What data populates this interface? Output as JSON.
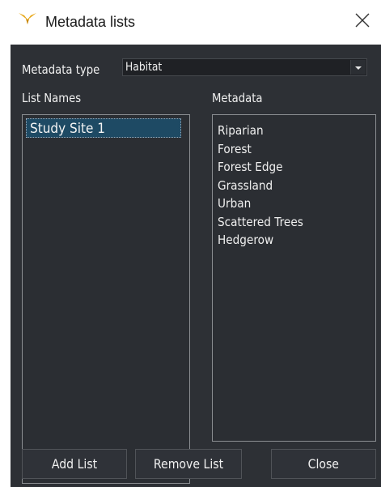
{
  "window": {
    "title": "Metadata lists",
    "app_icon": "bird-logo-icon",
    "close_icon": "close-icon",
    "accent_color": "#e8a91c"
  },
  "metadata_type": {
    "label": "Metadata type",
    "value": "Habitat"
  },
  "list_names": {
    "label": "List Names",
    "items": [
      "Study Site 1"
    ],
    "selected": "Study Site 1"
  },
  "metadata": {
    "label": "Metadata",
    "items": [
      "Riparian",
      "Forest",
      "Forest Edge",
      "Grassland",
      "Urban",
      "Scattered Trees",
      "Hedgerow"
    ]
  },
  "buttons": {
    "add_list": "Add List",
    "remove_list": "Remove List",
    "close": "Close"
  },
  "colors": {
    "panel_bg": "#2d3035",
    "selection": "#1e4a64",
    "text": "#f0f0f0"
  }
}
